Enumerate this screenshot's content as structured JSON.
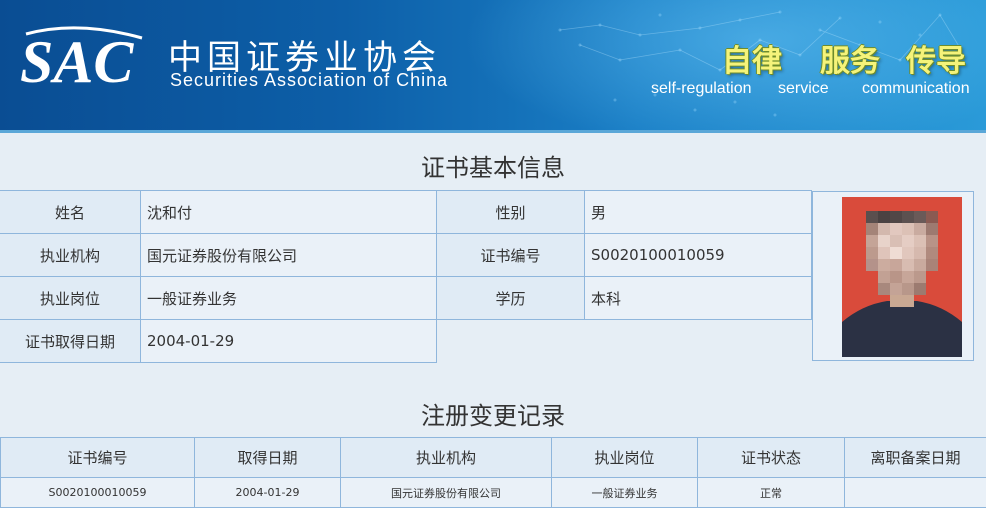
{
  "header": {
    "logo_mark": "SAC",
    "org_name_cn": "中国证券业协会",
    "org_name_en": "Securities Association of China",
    "slogans": [
      {
        "cn": "自律",
        "en": "self-regulation"
      },
      {
        "cn": "服务",
        "en": "service"
      },
      {
        "cn": "传导",
        "en": "communication"
      }
    ],
    "colors": {
      "banner_dark": "#0a4d93",
      "banner_light": "#2a9ad8",
      "slogan_yellow": "#f5f37a"
    }
  },
  "cert_info": {
    "title": "证书基本信息",
    "fields": {
      "name_label": "姓名",
      "name": "沈和付",
      "gender_label": "性别",
      "gender": "男",
      "org_label": "执业机构",
      "org": "国元证券股份有限公司",
      "cert_no_label": "证书编号",
      "cert_no": "S0020100010059",
      "position_label": "执业岗位",
      "position": "一般证券业务",
      "education_label": "学历",
      "education": "本科",
      "date_label": "证书取得日期",
      "date": "2004-01-29"
    }
  },
  "history": {
    "title": "注册变更记录",
    "columns": [
      "证书编号",
      "取得日期",
      "执业机构",
      "执业岗位",
      "证书状态",
      "离职备案日期"
    ],
    "rows": [
      [
        "S0020100010059",
        "2004-01-29",
        "国元证券股份有限公司",
        "一般证券业务",
        "正常",
        ""
      ]
    ]
  }
}
